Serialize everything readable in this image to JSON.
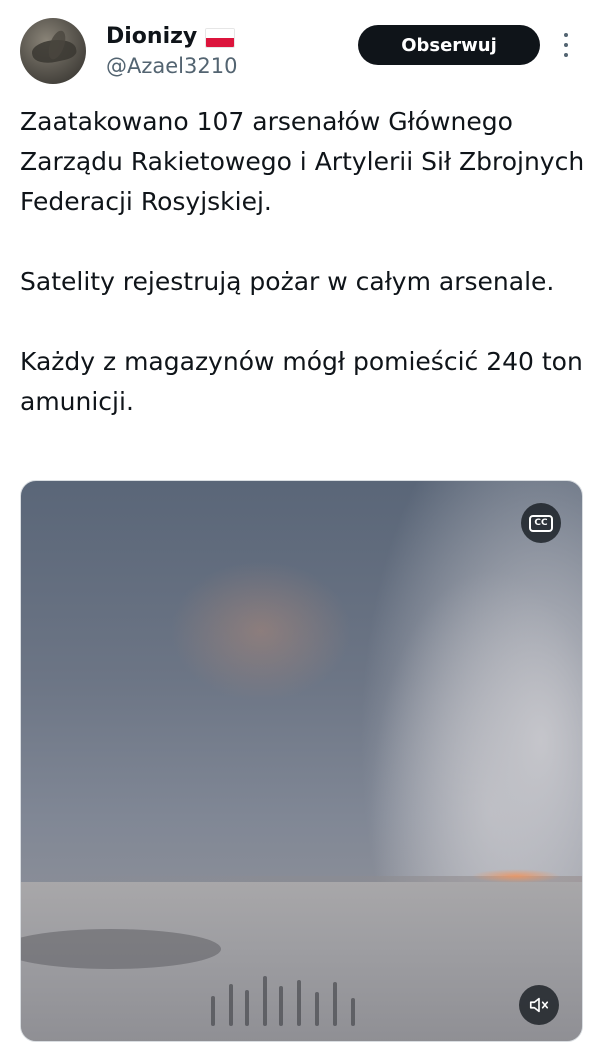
{
  "author": {
    "display_name": "Dionizy",
    "handle": "@Azael3210",
    "flag_icon": "poland-flag-icon",
    "avatar": "profile-avatar"
  },
  "actions": {
    "follow_label": "Obserwuj",
    "more_icon": "more-options-icon"
  },
  "tweet": {
    "paragraphs": [
      "Zaatakowano 107 arsenałów Głównego Zarządu Rakietowego i Artylerii Sił Zbrojnych Federacji Rosyjskiej.",
      "Satelity rejestrują pożar w całym arsenale.",
      "Każdy z magazynów mógł pomieścić 240 ton amunicji."
    ]
  },
  "media": {
    "type": "video",
    "captions_label": "CC",
    "captions_icon": "closed-captions-icon",
    "mute_icon": "muted-speaker-icon"
  },
  "colors": {
    "text": "#0f1419",
    "secondary": "#536471",
    "button_bg": "#0f1419",
    "button_text": "#ffffff"
  }
}
